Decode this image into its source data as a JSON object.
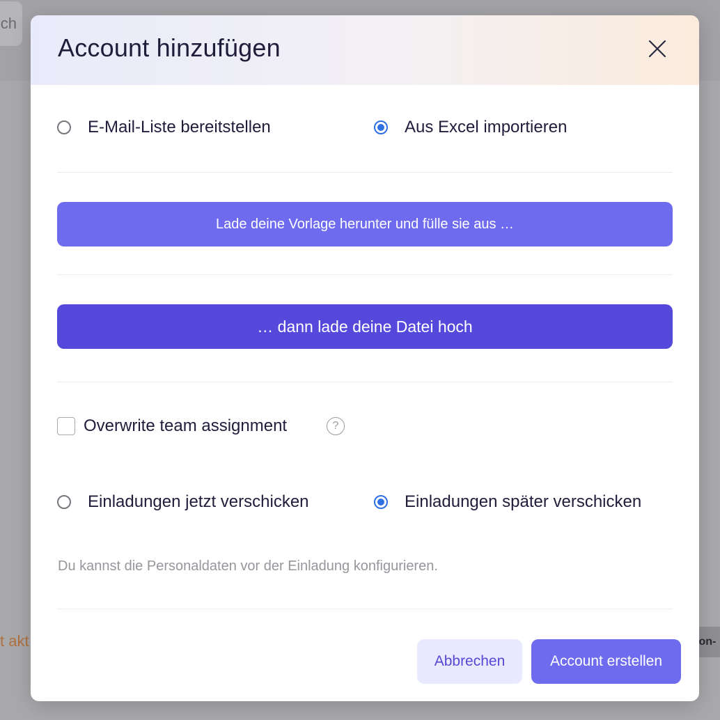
{
  "background": {
    "left_button_text": "ch",
    "left_text": "t akt",
    "right_chip_text": "lon-"
  },
  "modal": {
    "title": "Account hinzufügen",
    "close_icon": "close-icon",
    "source_options": [
      {
        "label": "E-Mail-Liste bereitstellen",
        "selected": false
      },
      {
        "label": "Aus Excel importieren",
        "selected": true
      }
    ],
    "template_button_label": "Lade deine Vorlage herunter und fülle sie aus …",
    "upload_button_label": "… dann lade deine Datei hoch",
    "overwrite_checkbox": {
      "label": "Overwrite team assignment",
      "checked": false,
      "help_icon": "help-icon",
      "help_glyph": "?"
    },
    "invite_options": [
      {
        "label": "Einladungen jetzt verschicken",
        "selected": false
      },
      {
        "label": "Einladungen später verschicken",
        "selected": true
      }
    ],
    "hint": "Du kannst die Personaldaten vor der Einladung konfigurieren.",
    "cancel_label": "Abbrechen",
    "create_label": "Account erstellen"
  },
  "colors": {
    "accent": "#6e6bef",
    "accent_dark": "#5549dc",
    "radio_selected": "#2f6fe4",
    "cancel_bg": "#e9eaff"
  }
}
